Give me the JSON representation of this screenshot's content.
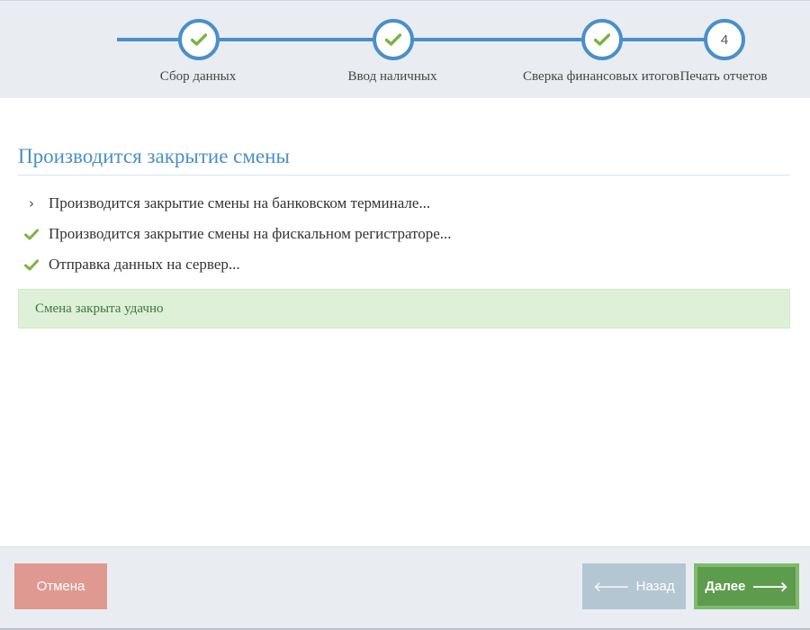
{
  "wizard": {
    "steps": [
      {
        "label": "Сбор данных",
        "state": "done",
        "icon": "check-icon"
      },
      {
        "label": "Ввод наличных",
        "state": "done",
        "icon": "check-icon"
      },
      {
        "label": "Сверка финансовых итогов",
        "state": "done",
        "icon": "check-icon"
      },
      {
        "label": "Печать отчетов",
        "state": "current",
        "number": "4"
      }
    ]
  },
  "main": {
    "title": "Производится закрытие смены",
    "items": [
      {
        "text": "Производится закрытие смены на банковском терминале...",
        "icon": "chevron-right-icon"
      },
      {
        "text": "Производится закрытие смены на фискальном регистраторе...",
        "icon": "check-icon"
      },
      {
        "text": "Отправка данных на сервер...",
        "icon": "check-icon"
      }
    ],
    "alert": "Смена закрыта удачно"
  },
  "footer": {
    "cancel_label": "Отмена",
    "back_label": "Назад",
    "next_label": "Далее"
  },
  "colors": {
    "accent": "#4a8fca",
    "check": "#7cb342",
    "success_bg": "#dff0d8",
    "success_text": "#3c763d",
    "cancel": "#e09990",
    "back_disabled": "#b5c6d3",
    "next": "#5e9c4d"
  }
}
